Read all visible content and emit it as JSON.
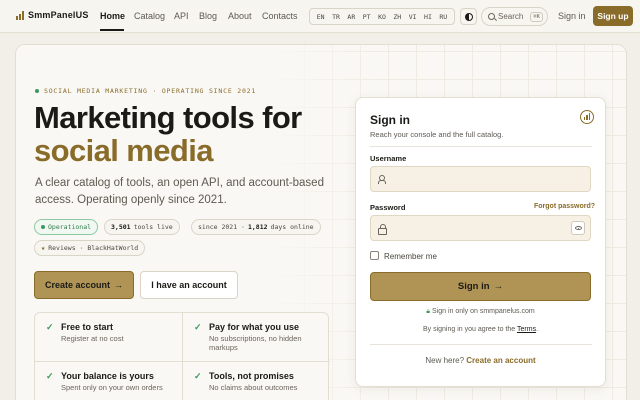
{
  "brand": {
    "name": "SmmPanelUS",
    "accent": "#8a6c2a",
    "button_fill": "#b09455",
    "success": "#3a9a5b"
  },
  "nav": {
    "items": [
      "Home",
      "Catalog",
      "API",
      "Blog",
      "About",
      "Contacts"
    ],
    "active": "Home"
  },
  "languages": [
    "EN",
    "TR",
    "AR",
    "PT",
    "KO",
    "ZH",
    "VI",
    "HI",
    "RU"
  ],
  "header": {
    "theme_icon": "contrast-icon",
    "search_label": "Search",
    "search_shortcut": "⌘K",
    "signin_label": "Sign in",
    "signup_label": "Sign up"
  },
  "hero": {
    "eyebrow": "SOCIAL MEDIA MARKETING · OPERATING SINCE 2021",
    "title_line1": "Marketing tools for",
    "title_line2": "social media",
    "subtitle": "A clear catalog of tools, an open API, and account-based access. Operating openly since 2021.",
    "status_pill": "Operational",
    "tools_count": "3,501",
    "tools_suffix": "tools live",
    "since_prefix": "since 2021 ·",
    "days_count": "1,812",
    "days_suffix": "days online",
    "reviews_pill": "Reviews · BlackHatWorld",
    "cta_primary": "Create account",
    "cta_primary_arrow": "→",
    "cta_secondary": "I have an account"
  },
  "features": [
    {
      "title": "Free to start",
      "desc": "Register at no cost"
    },
    {
      "title": "Pay for what you use",
      "desc": "No subscriptions, no hidden markups"
    },
    {
      "title": "Your balance is yours",
      "desc": "Spent only on your own orders"
    },
    {
      "title": "Tools, not promises",
      "desc": "No claims about outcomes"
    }
  ],
  "signin_card": {
    "title": "Sign in",
    "subtitle": "Reach your console and the full catalog.",
    "username_label": "Username",
    "username_value": "",
    "password_label": "Password",
    "password_value": "",
    "forgot_label": "Forgot password?",
    "remember_label": "Remember me",
    "remember_checked": false,
    "submit_label": "Sign in",
    "submit_arrow": "→",
    "secure_note": "Sign in only on smmpanelus.com",
    "terms_prefix": "By signing in you agree to the",
    "terms_link": "Terms",
    "terms_suffix": ".",
    "new_here": "New here?",
    "create_link": "Create an account"
  }
}
